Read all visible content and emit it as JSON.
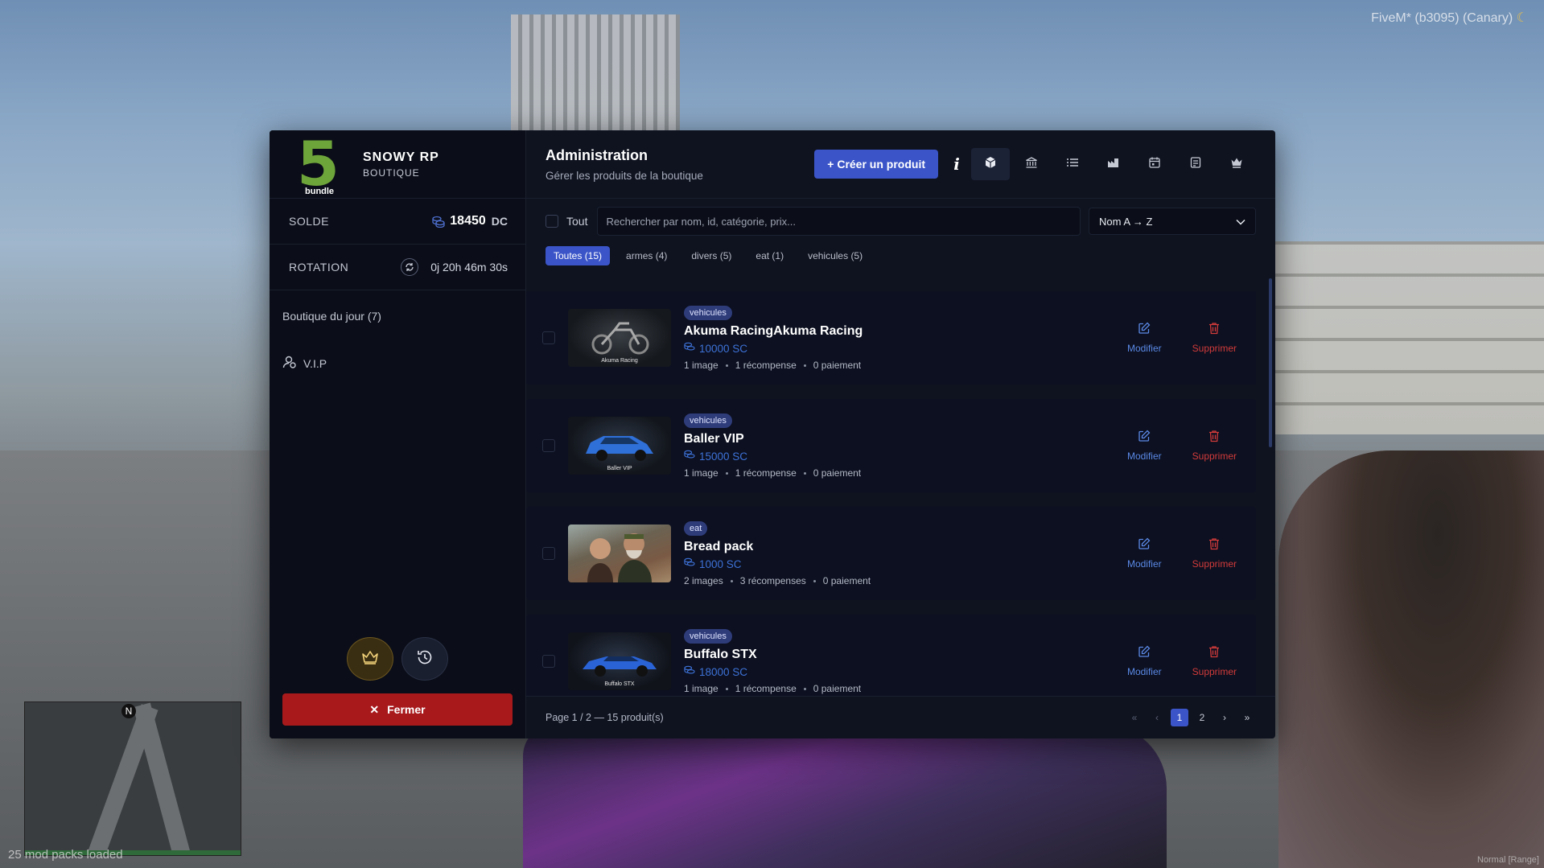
{
  "overlay": {
    "fivem_label": "FiveM* (b3095) (Canary)",
    "mod_packs": "25 mod packs loaded",
    "voice_mode": "Normal [Range]",
    "minimap_north": "N"
  },
  "sidebar": {
    "brand_logo_number": "5",
    "brand_logo_caption": "bundle",
    "brand_name": "SNOWY RP",
    "brand_sub": "BOUTIQUE",
    "balance_label": "SOLDE",
    "balance_value": "18450",
    "balance_unit": "DC",
    "rotation_label": "ROTATION",
    "rotation_value": "0j 20h 46m 30s",
    "nav": [
      {
        "label": "Boutique du jour (7)"
      },
      {
        "label": "V.I.P"
      }
    ],
    "close_label": "Fermer"
  },
  "header": {
    "title": "Administration",
    "subtitle": "Gérer les produits de la boutique",
    "create_label": "+ Créer un produit",
    "info_label": "i"
  },
  "filters": {
    "select_all_label": "Tout",
    "search_placeholder": "Rechercher par nom, id, catégorie, prix...",
    "sort_value": "Nom A → Z",
    "tabs": [
      {
        "label": "Toutes (15)"
      },
      {
        "label": "armes (4)"
      },
      {
        "label": "divers (5)"
      },
      {
        "label": "eat (1)"
      },
      {
        "label": "vehicules (5)"
      }
    ]
  },
  "products": [
    {
      "tag": "vehicules",
      "name": "Akuma RacingAkuma Racing",
      "price": "10000 SC",
      "images": "1 image",
      "rewards": "1 récompense",
      "payments": "0 paiement",
      "thumb_caption": "Akuma Racing"
    },
    {
      "tag": "vehicules",
      "name": "Baller VIP",
      "price": "15000 SC",
      "images": "1 image",
      "rewards": "1 récompense",
      "payments": "0 paiement",
      "thumb_caption": "Baller VIP"
    },
    {
      "tag": "eat",
      "name": "Bread pack",
      "price": "1000 SC",
      "images": "2 images",
      "rewards": "3 récompenses",
      "payments": "0 paiement",
      "thumb_caption": ""
    },
    {
      "tag": "vehicules",
      "name": "Buffalo STX",
      "price": "18000 SC",
      "images": "1 image",
      "rewards": "1 récompense",
      "payments": "0 paiement",
      "thumb_caption": "Buffalo STX"
    }
  ],
  "actions": {
    "edit_label": "Modifier",
    "delete_label": "Supprimer"
  },
  "footer": {
    "page_info": "Page 1 / 2 — 15 produit(s)",
    "first": "«",
    "prev": "‹",
    "pages": [
      "1",
      "2"
    ],
    "next": "›",
    "last": "»"
  },
  "colors": {
    "accent": "#3b55c8",
    "close_button": "#a8191c",
    "delete": "#d23b3b",
    "edit": "#5b89e6",
    "logo_green": "#6ea53a"
  }
}
